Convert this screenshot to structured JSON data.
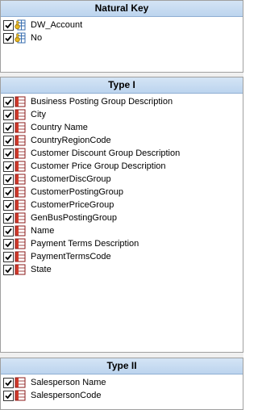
{
  "colors": {
    "header_bg": "#c8dcf2",
    "table_icon_red": "#c0392b",
    "key_icon_gold": "#d4a017",
    "check": "#000000"
  },
  "sections": [
    {
      "title": "Natural Key",
      "icon": "key-column-icon",
      "items": [
        {
          "label": "DW_Account",
          "checked": true
        },
        {
          "label": "No",
          "checked": true
        }
      ]
    },
    {
      "title": "Type I",
      "icon": "table-column-icon",
      "items": [
        {
          "label": "Business Posting Group Description",
          "checked": true
        },
        {
          "label": "City",
          "checked": true
        },
        {
          "label": "Country Name",
          "checked": true
        },
        {
          "label": "CountryRegionCode",
          "checked": true
        },
        {
          "label": "Customer Discount Group Description",
          "checked": true
        },
        {
          "label": "Customer Price Group Description",
          "checked": true
        },
        {
          "label": "CustomerDiscGroup",
          "checked": true
        },
        {
          "label": "CustomerPostingGroup",
          "checked": true
        },
        {
          "label": "CustomerPriceGroup",
          "checked": true
        },
        {
          "label": "GenBusPostingGroup",
          "checked": true
        },
        {
          "label": "Name",
          "checked": true
        },
        {
          "label": "Payment Terms Description",
          "checked": true
        },
        {
          "label": "PaymentTermsCode",
          "checked": true
        },
        {
          "label": "State",
          "checked": true
        }
      ]
    },
    {
      "title": "Type II",
      "icon": "table-column-icon",
      "items": [
        {
          "label": "Salesperson Name",
          "checked": true
        },
        {
          "label": "SalespersonCode",
          "checked": true
        }
      ]
    }
  ]
}
